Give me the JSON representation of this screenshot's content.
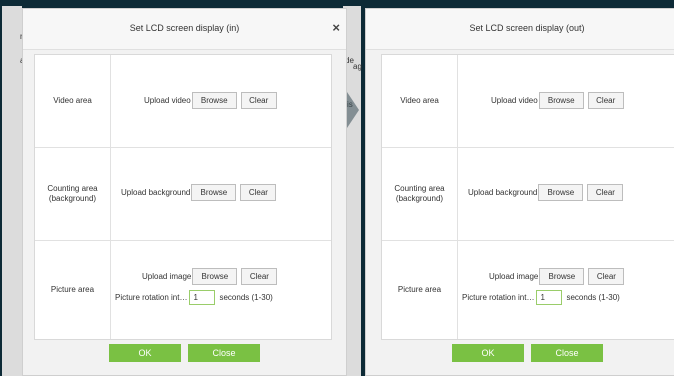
{
  "background": {
    "left_fragments": [
      "nt",
      "ag"
    ],
    "middle_fragments": [
      "nt",
      "de",
      "ag",
      "is"
    ]
  },
  "dialog_in": {
    "title": "Set LCD screen display (in)",
    "close_glyph": "×",
    "rows": {
      "video": {
        "label": "Video area",
        "upload_label": "Upload video",
        "browse": "Browse",
        "clear": "Clear"
      },
      "counting": {
        "label_line1": "Counting area",
        "label_line2": "(background)",
        "upload_label": "Upload background",
        "browse": "Browse",
        "clear": "Clear"
      },
      "picture": {
        "label": "Picture area",
        "upload_label": "Upload image",
        "browse": "Browse",
        "clear": "Clear",
        "rotation_label": "Picture rotation int…",
        "rotation_value": "1",
        "rotation_unit": "seconds (1-30)"
      }
    },
    "ok": "OK",
    "close": "Close"
  },
  "dialog_out": {
    "title": "Set LCD screen display (out)",
    "rows": {
      "video": {
        "label": "Video area",
        "upload_label": "Upload video",
        "browse": "Browse",
        "clear": "Clear"
      },
      "counting": {
        "label_line1": "Counting area",
        "label_line2": "(background)",
        "upload_label": "Upload background",
        "browse": "Browse",
        "clear": "Clear"
      },
      "picture": {
        "label": "Picture area",
        "upload_label": "Upload image",
        "browse": "Browse",
        "clear": "Clear",
        "rotation_label": "Picture rotation int…",
        "rotation_value": "1",
        "rotation_unit": "seconds (1-30)"
      }
    },
    "ok": "OK",
    "close": "Close"
  },
  "colors": {
    "background": "#0d2a36",
    "primary_button": "#7ac143",
    "input_border": "#9acd6a"
  }
}
